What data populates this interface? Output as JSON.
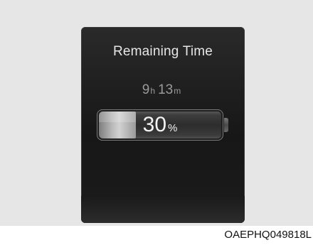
{
  "display": {
    "title": "Remaining Time",
    "hours": "9",
    "hours_unit": "h",
    "minutes": "13",
    "minutes_unit": "m",
    "battery_percent_value": "30",
    "battery_percent_unit": "%",
    "battery_level": 0.3
  },
  "figure_code": "OAEPHQ049818L",
  "colors": {
    "background": "#e6e6e6",
    "screen": "#1b1b1b",
    "title_text": "#e6e6e6",
    "time_text": "#9a9a9a",
    "battery_fill": "#c4c4c4"
  }
}
